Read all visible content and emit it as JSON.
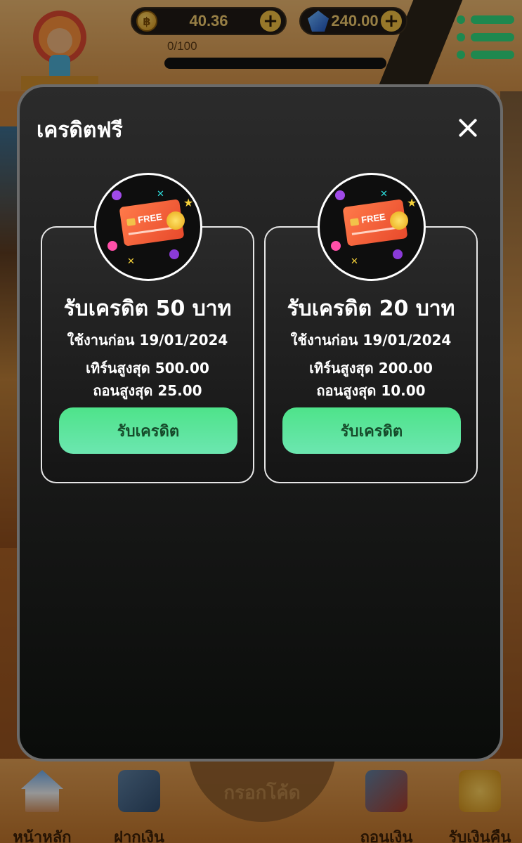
{
  "header": {
    "coin_balance": "40.36",
    "gem_balance": "240.00",
    "progress_text": "0/100",
    "progress_fraction": 0.0
  },
  "modal": {
    "title": "เครดิตฟรี",
    "cards": [
      {
        "badge_text": "FREE",
        "title": "รับเครดิต 50 บาท",
        "expiry": "ใช้งานก่อน 19/01/2024",
        "max_turnover": "เทิร์นสูงสุด 500.00",
        "max_withdraw": "ถอนสูงสุด 25.00",
        "button_label": "รับเครดิต"
      },
      {
        "badge_text": "FREE",
        "title": "รับเครดิต 20 บาท",
        "expiry": "ใช้งานก่อน 19/01/2024",
        "max_turnover": "เทิร์นสูงสุด 200.00",
        "max_withdraw": "ถอนสูงสุด 10.00",
        "button_label": "รับเครดิต"
      }
    ]
  },
  "bottom_nav": {
    "items": [
      {
        "label": "หน้าหลัก",
        "icon": "home-icon"
      },
      {
        "label": "ฝากเงิน",
        "icon": "deposit-icon"
      },
      {
        "label": "กรอกโค้ด",
        "icon": "code-icon"
      },
      {
        "label": "ถอนเงิน",
        "icon": "withdraw-icon"
      },
      {
        "label": "รับเงินคืน",
        "icon": "cashback-icon"
      }
    ]
  },
  "colors": {
    "accent_green": "#4ee38a",
    "modal_bg": "#1c1c1c",
    "coin_text": "#e8c36a",
    "menu_green": "#2ed17a"
  }
}
